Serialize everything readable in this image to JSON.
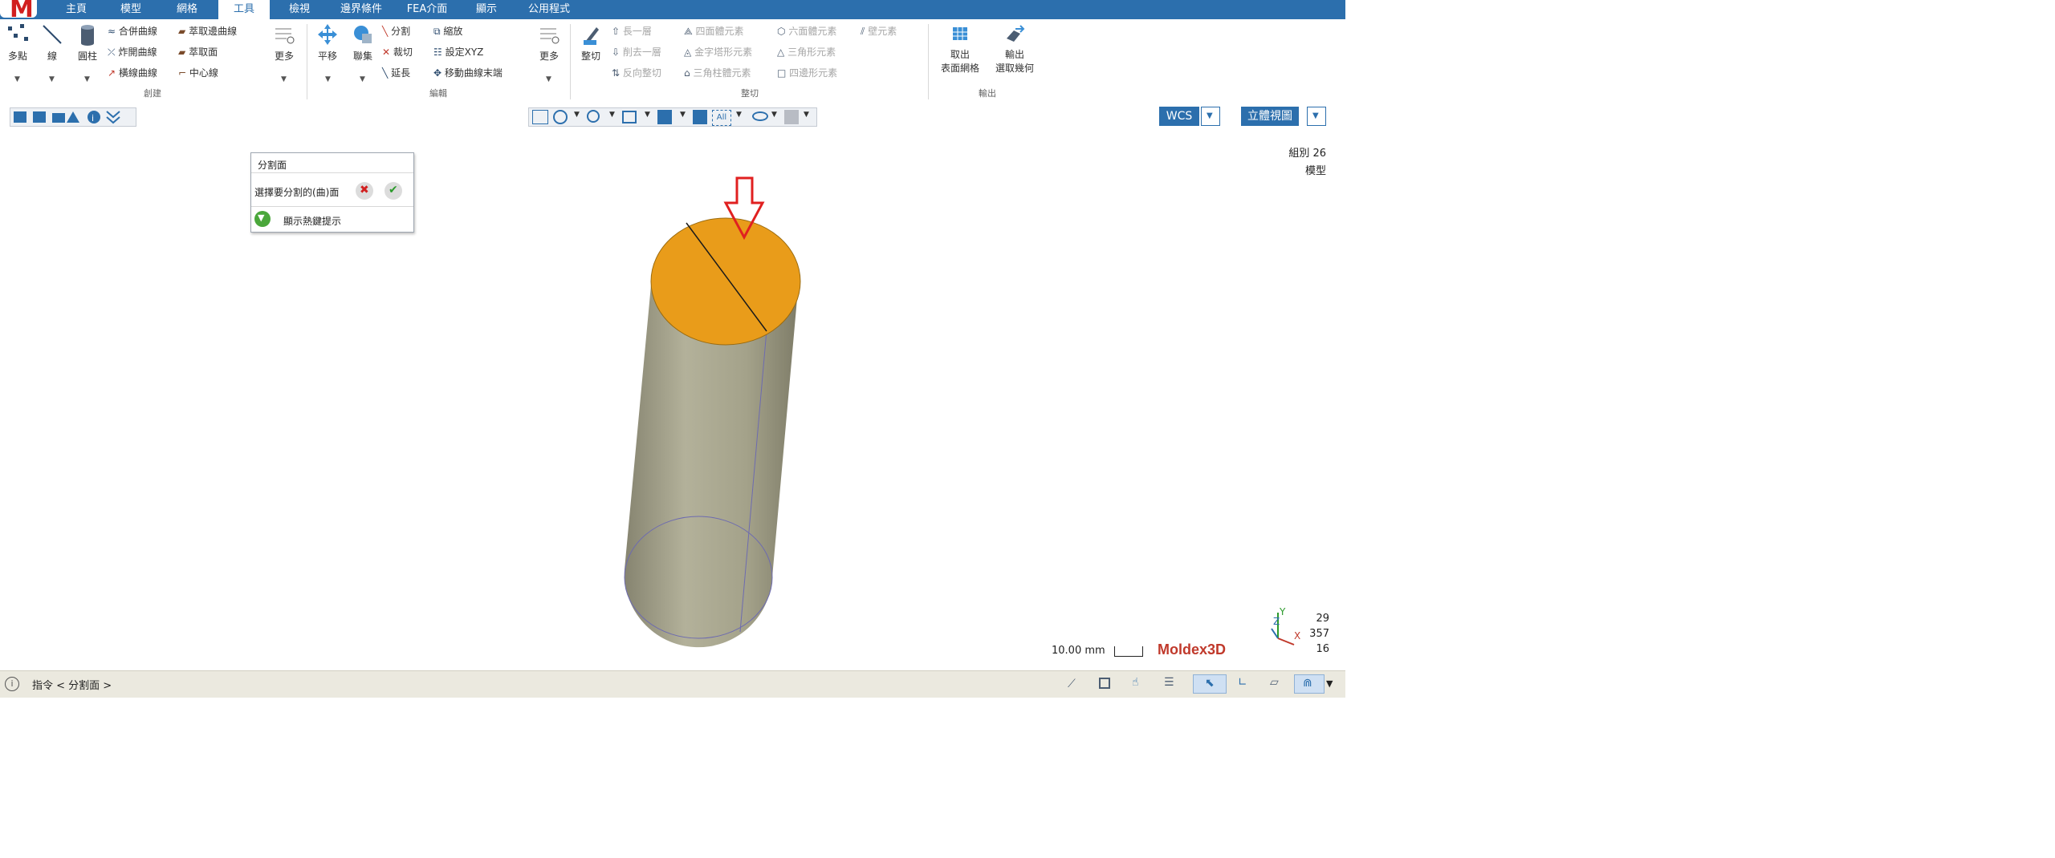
{
  "app": {
    "logo_letter": "M"
  },
  "tabs": [
    {
      "label": "主頁"
    },
    {
      "label": "模型"
    },
    {
      "label": "網格"
    },
    {
      "label": "工具",
      "active": true
    },
    {
      "label": "檢視"
    },
    {
      "label": "邊界條件"
    },
    {
      "label": "FEA介面"
    },
    {
      "label": "顯示"
    },
    {
      "label": "公用程式"
    }
  ],
  "ribbon": {
    "create": {
      "group_label": "創建",
      "multipoint": "多點",
      "line": "線",
      "cylinder": "圓柱",
      "merge_curve": "合併曲線",
      "extract_edge_curve": "萃取邊曲線",
      "explode_curve": "炸開曲線",
      "extract_face": "萃取面",
      "cross_curve": "橫線曲線",
      "centerline": "中心線",
      "more": "更多"
    },
    "edit": {
      "group_label": "編輯",
      "translate": "平移",
      "union": "聯集",
      "split": "分割",
      "scale": "縮放",
      "trim": "裁切",
      "set_xyz": "設定XYZ",
      "extend": "延長",
      "move_curve_end": "移動曲線末端",
      "more": "更多"
    },
    "trim": {
      "group_label": "整切",
      "trim": "整切",
      "grow_layer": "長一層",
      "remove_layer": "削去一層",
      "reverse_trim": "反向整切",
      "tetra": "四面體元素",
      "pyramid": "金字塔形元素",
      "prism": "三角柱體元素",
      "hexa": "六面體元素",
      "tri": "三角形元素",
      "quad": "四邊形元素",
      "wall": "壁元素"
    },
    "output": {
      "group_label": "輸出",
      "get_surface_mesh_1": "取出",
      "get_surface_mesh_2": "表面網格",
      "output_geometry_1": "輸出",
      "output_geometry_2": "選取幾何"
    }
  },
  "viewbar": {
    "wcs_label": "WCS",
    "view_label": "立體視圖",
    "filter_label": "All"
  },
  "viewport": {
    "group_label": "組別 26",
    "model_label": "模型",
    "scale_label": "10.00 mm",
    "watermark": "Moldex3D",
    "triad": {
      "x": "X",
      "y": "Y",
      "z": "Z"
    },
    "rotation": [
      "29",
      "357",
      "16"
    ],
    "colors": {
      "cylinder_body": "#a4a28a",
      "top_face": "#e99c1a",
      "arrow": "#e02020"
    }
  },
  "dialog": {
    "title": "分割面",
    "prompt": "選擇要分割的(曲)面",
    "hint": "顯示熱鍵提示"
  },
  "status": {
    "command_text": "指令 < 分割面 >"
  }
}
